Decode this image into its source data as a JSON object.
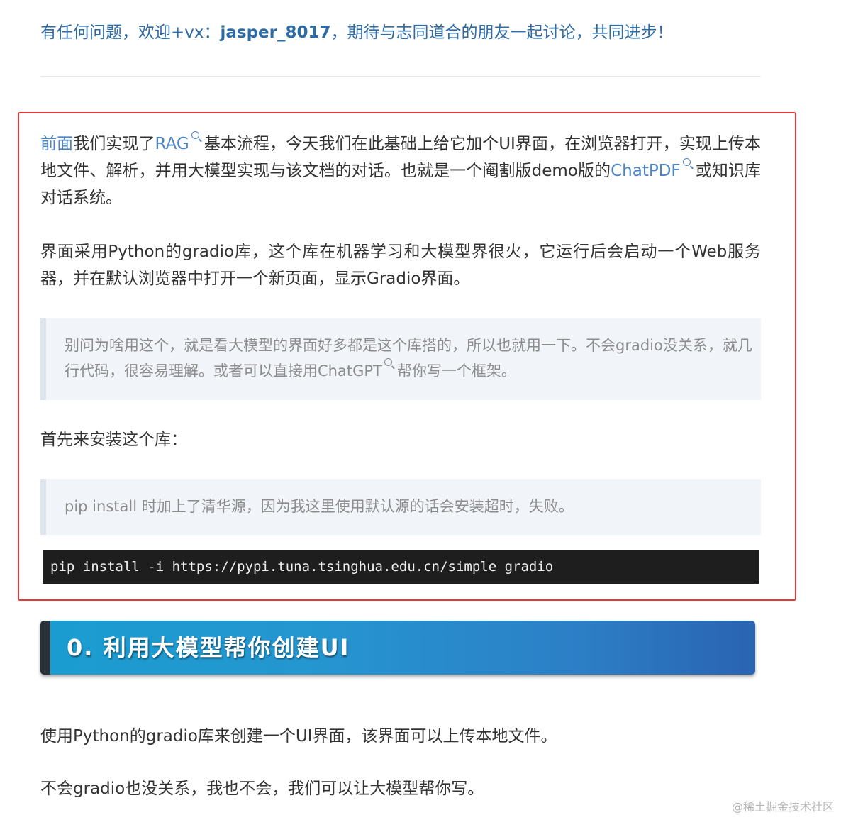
{
  "contact": {
    "prefix": "有任何问题，欢迎+vx：",
    "id": "jasper_8017",
    "suffix": "，期待与志同道合的朋友一起讨论，共同进步！"
  },
  "intro": {
    "p1_a": "前面",
    "p1_b": "我们实现了",
    "p1_link1": "RAG",
    "p1_c": "基本流程，今天我们在此基础上给它加个UI界面，在浏览器打开，实现上传本地文件、解析，并用大模型实现与该文档的对话。也就是一个阉割版demo版的",
    "p1_link2": "ChatPDF",
    "p1_d": "或知识库对话系统。",
    "p2": "界面采用Python的gradio库，这个库在机器学习和大模型界很火，它运行后会启动一个Web服务器，并在默认浏览器中打开一个新页面，显示Gradio界面。"
  },
  "quote1": {
    "a": "别问为啥用这个，就是看大模型的界面好多都是这个库搭的，所以也就用一下。不会gradio没关系，就几行代码，很容易理解。或者可以直接用",
    "link": "ChatGPT",
    "b": "帮你写一个框架。"
  },
  "install": {
    "label": "首先来安装这个库：",
    "note": "pip install 时加上了清华源，因为我这里使用默认源的话会安装超时，失败。",
    "code": "pip install -i https://pypi.tuna.tsinghua.edu.cn/simple gradio"
  },
  "section": {
    "heading": "0. 利用大模型帮你创建UI",
    "p1": "使用Python的gradio库来创建一个UI界面，该界面可以上传本地文件。",
    "p2": "不会gradio也没关系，我也不会，我们可以让大模型帮你写。"
  },
  "watermark": "@稀土掘金技术社区",
  "colors": {
    "link": "#4c84c4",
    "highlight_border": "#e53935",
    "heading_gradient_start": "#1a9dd0",
    "heading_gradient_end": "#2a63b1"
  }
}
